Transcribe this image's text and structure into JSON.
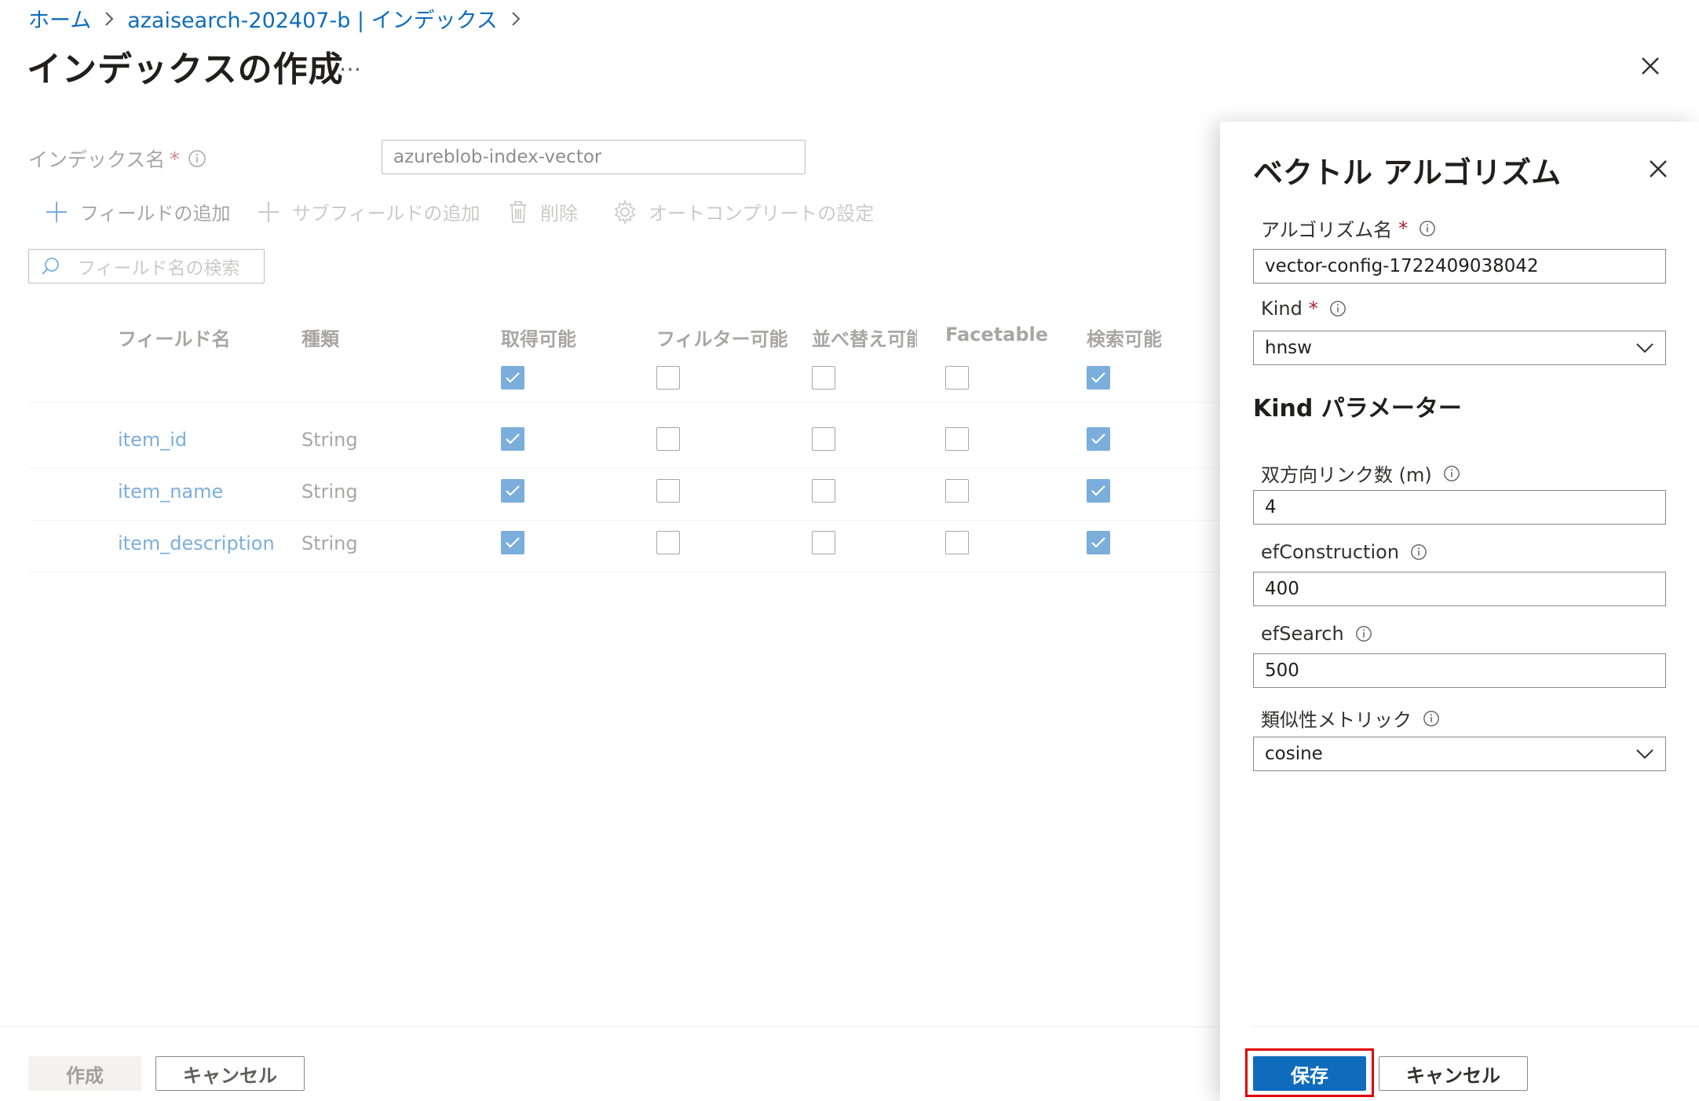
{
  "breadcrumb": {
    "home": "ホーム",
    "service": "azaisearch-202407-b | インデックス"
  },
  "page": {
    "title": "インデックスの作成",
    "more": "…"
  },
  "form": {
    "index_name_label": "インデックス名",
    "required_mark": "*",
    "index_name_value": "azureblob-index-vector"
  },
  "toolbar": {
    "add_field": "フィールドの追加",
    "add_subfield": "サブフィールドの追加",
    "delete": "削除",
    "autocomplete": "オートコンプリートの設定"
  },
  "search": {
    "placeholder": "フィールド名の検索"
  },
  "table": {
    "headers": {
      "name": "フィールド名",
      "type": "種類",
      "retrievable": "取得可能",
      "filterable": "フィルター可能",
      "sortable": "並べ替え可能",
      "facetable": "Facetable",
      "searchable": "検索可能"
    },
    "header_checks": [
      true,
      false,
      false,
      false,
      true
    ],
    "rows": [
      {
        "name": "item_id",
        "type": "String",
        "checks": [
          true,
          false,
          false,
          false,
          true
        ]
      },
      {
        "name": "item_name",
        "type": "String",
        "checks": [
          true,
          false,
          false,
          false,
          true
        ]
      },
      {
        "name": "item_description",
        "type": "String",
        "checks": [
          true,
          false,
          false,
          false,
          true
        ]
      }
    ]
  },
  "footer": {
    "create": "作成",
    "cancel": "キャンセル"
  },
  "panel": {
    "title": "ベクトル アルゴリズム",
    "algorithm_name_label": "アルゴリズム名",
    "required_mark": "*",
    "algorithm_name_value": "vector-config-1722409038042",
    "kind_label": "Kind",
    "kind_value": "hnsw",
    "params_title": "Kind パラメーター",
    "m_label": "双方向リンク数 (m)",
    "m_value": "4",
    "efc_label": "efConstruction",
    "efc_value": "400",
    "efs_label": "efSearch",
    "efs_value": "500",
    "metric_label": "類似性メトリック",
    "metric_value": "cosine",
    "save": "保存",
    "cancel": "キャンセル",
    "highlight_color": "#e00000"
  },
  "colors": {
    "accent": "#0f6cbd",
    "link": "#0f6cbd"
  }
}
